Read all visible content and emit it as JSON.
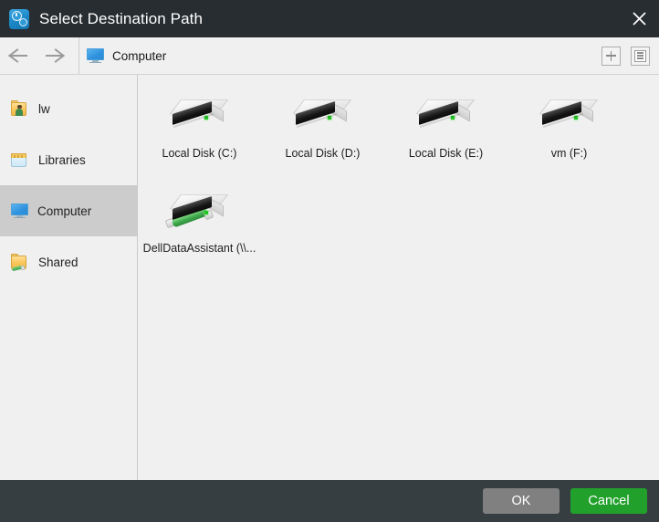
{
  "window": {
    "title": "Select Destination Path",
    "app_icon": "clock-gear-icon",
    "close_icon": "close-icon"
  },
  "toolbar": {
    "back_icon": "arrow-left-icon",
    "forward_icon": "arrow-right-icon",
    "breadcrumb": {
      "icon": "computer-monitor-icon",
      "label": "Computer"
    },
    "new_folder_icon": "plus-icon",
    "view_toggle_icon": "list-view-icon"
  },
  "sidebar": {
    "items": [
      {
        "label": "lw",
        "icon": "user-folder-icon",
        "selected": false
      },
      {
        "label": "Libraries",
        "icon": "libraries-folder-icon",
        "selected": false
      },
      {
        "label": "Computer",
        "icon": "computer-monitor-icon",
        "selected": true
      },
      {
        "label": "Shared",
        "icon": "shared-folder-icon",
        "selected": false
      }
    ]
  },
  "content": {
    "items": [
      {
        "label": "Local Disk (C:)",
        "icon": "hard-drive-icon",
        "network": false
      },
      {
        "label": "Local Disk (D:)",
        "icon": "hard-drive-icon",
        "network": false
      },
      {
        "label": "Local Disk (E:)",
        "icon": "hard-drive-icon",
        "network": false
      },
      {
        "label": "vm (F:)",
        "icon": "hard-drive-icon",
        "network": false
      },
      {
        "label": "DellDataAssistant (\\\\...",
        "icon": "network-drive-icon",
        "network": true
      }
    ]
  },
  "footer": {
    "ok_label": "OK",
    "cancel_label": "Cancel"
  },
  "colors": {
    "titlebar": "#282d31",
    "footer": "#363e42",
    "accent_green": "#22a02c",
    "ok_gray": "#808080",
    "selection": "#cccccc",
    "panel": "#f0f0f0"
  }
}
